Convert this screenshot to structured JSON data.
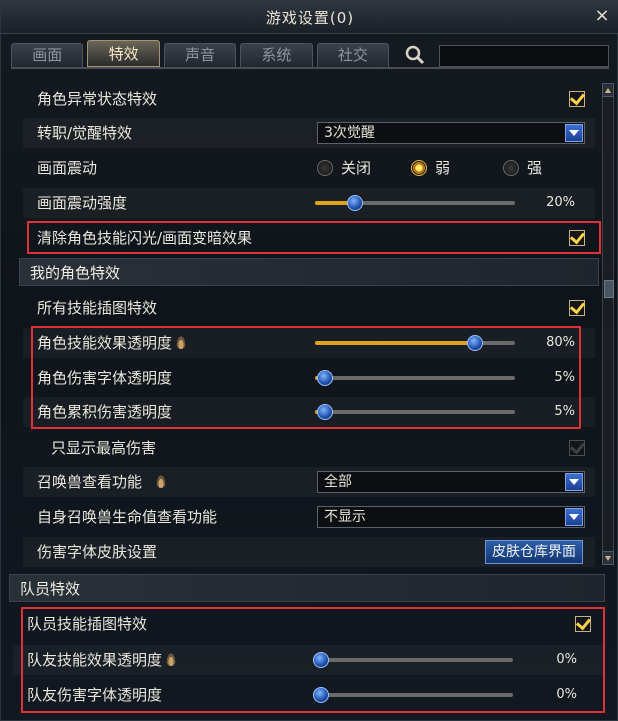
{
  "window": {
    "title": "游戏设置(0)",
    "close_icon": "×"
  },
  "tabs": [
    {
      "label": "画面",
      "active": false
    },
    {
      "label": "特效",
      "active": true
    },
    {
      "label": "声音",
      "active": false
    },
    {
      "label": "系统",
      "active": false
    },
    {
      "label": "社交",
      "active": false
    }
  ],
  "search": {
    "value": "",
    "icon": "search-icon"
  },
  "settings": {
    "abnormal_status": {
      "label": "角色异常状态特效",
      "checked": true
    },
    "job_awaken": {
      "label": "转职/觉醒特效",
      "selected": "3次觉醒"
    },
    "screen_shake": {
      "label": "画面震动",
      "options": [
        "关闭",
        "弱",
        "强"
      ],
      "selected": "弱"
    },
    "shake_intensity": {
      "label": "画面震动强度",
      "value_text": "20%",
      "value": 0.2
    },
    "clear_flash": {
      "label": "清除角色技能闪光/画面变暗效果",
      "checked": true
    }
  },
  "my_char_section": {
    "title": "我的角色特效"
  },
  "my_char": {
    "all_skill_art": {
      "label": "所有技能插图特效",
      "checked": true
    },
    "skill_effect_opacity": {
      "label": "角色技能效果透明度",
      "value_text": "80%",
      "value": 0.8
    },
    "damage_font_opacity": {
      "label": "角色伤害字体透明度",
      "value_text": "5%",
      "value": 0.05
    },
    "accum_damage_opacity": {
      "label": "角色累积伤害透明度",
      "value_text": "5%",
      "value": 0.05
    },
    "show_max_damage": {
      "label": "只显示最高伤害",
      "checked": true,
      "disabled": true
    },
    "summon_view": {
      "label": "召唤兽查看功能",
      "selected": "全部"
    },
    "summon_hp_view": {
      "label": "自身召唤兽生命值查看功能",
      "selected": "不显示"
    },
    "damage_font_skin": {
      "label": "伤害字体皮肤设置",
      "button": "皮肤仓库界面"
    }
  },
  "team_section": {
    "title": "队员特效"
  },
  "team": {
    "member_skill_art": {
      "label": "队员技能插图特效",
      "checked": true
    },
    "ally_skill_opacity": {
      "label": "队友技能效果透明度",
      "value_text": "0%",
      "value": 0.0
    },
    "ally_damage_font_opacity": {
      "label": "队友伤害字体透明度",
      "value_text": "0%",
      "value": 0.0
    }
  },
  "colors": {
    "accent": "#e0a21b",
    "highlight_box": "#e0313b",
    "slider_knob": "#1e4ea8"
  }
}
